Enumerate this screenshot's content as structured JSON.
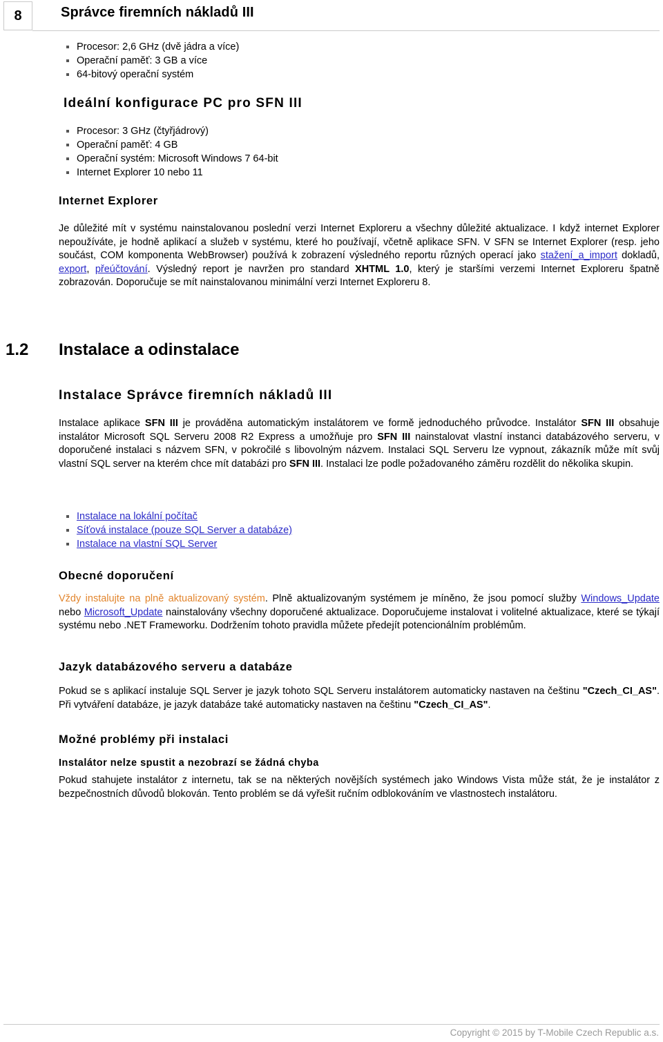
{
  "header": {
    "page_number": "8",
    "title": "Správce firemních nákladů III"
  },
  "requirements_min": {
    "items": [
      "Procesor: 2,6 GHz (dvě jádra a více)",
      "Operační paměť: 3 GB a více",
      "64-bitový operační systém"
    ]
  },
  "ideal_config": {
    "heading": "Ideální konfigurace PC pro SFN III",
    "items": [
      "Procesor: 3 GHz (čtyřjádrový)",
      "Operační paměť: 4 GB",
      "Operační systém: Microsoft Windows 7 64-bit",
      "Internet Explorer 10 nebo 11"
    ]
  },
  "internet_explorer": {
    "heading": "Internet Explorer",
    "para_part1": "Je důležité mít v systému nainstalovanou poslední verzi Internet Exploreru a všechny důležité aktualizace. I když internet Explorer nepoužíváte, je hodně aplikací a služeb v systému, které ho používají, včetně aplikace SFN. V SFN se Internet Explorer (resp. jeho součást, COM komponenta WebBrowser) používá k zobrazení výsledného reportu různých operací jako ",
    "link_download": "stažení_a_import",
    "para_part2": " dokladů, ",
    "link_export": "export",
    "para_part3": ", ",
    "link_repost": "přeúčtování",
    "para_part4": ". Výsledný report je navržen pro standard ",
    "standard_bold": "XHTML 1.0",
    "para_part5": ", který je staršími verzemi Internet Exploreru špatně zobrazován. Doporučuje se mít nainstalovanou minimální verzi Internet Exploreru 8."
  },
  "section_1_2": {
    "number": "1.2",
    "title": "Instalace a odinstalace"
  },
  "install_sfn": {
    "heading": "Instalace Správce firemních nákladů III",
    "p1_a": "Instalace aplikace ",
    "p1_b": "SFN III",
    "p1_c": " je prováděna automatickým instalátorem ve formě jednoduchého průvodce. Instalátor ",
    "p1_d": "SFN III",
    "p1_e": " obsahuje instalátor Microsoft SQL Serveru 2008 R2 Express a umožňuje pro ",
    "p1_f": "SFN III",
    "p1_g": " nainstalovat vlastní instanci databázového serveru, v doporučené instalaci s názvem SFN, v pokročilé s libovolným názvem. Instalaci SQL Serveru lze vypnout, zákazník může mít svůj vlastní SQL server na kterém chce mít databázi pro ",
    "p1_h": "SFN III",
    "p1_i": ". Instalaci lze podle požadovaného záměru rozdělit do několika skupin.",
    "links": [
      "Instalace na lokální počítač",
      "Síťová instalace (pouze SQL Server a databáze)",
      "Instalace na vlastní SQL Server"
    ]
  },
  "general_recommendation": {
    "heading": "Obecné doporučení",
    "highlight": "Vždy instalujte na plně aktualizovaný systém",
    "p_a": ". Plně aktualizovaným systémem je míněno, že jsou pomocí služby ",
    "link_windows_update": "Windows_Update",
    "p_b": " nebo ",
    "link_microsoft_update": "Microsoft_Update",
    "p_c": " nainstalovány všechny doporučené aktualizace. Doporučujeme instalovat i volitelné aktualizace, které se týkají systému nebo .NET Frameworku. Dodržením tohoto pravidla můžete předejít potencionálním problémům."
  },
  "db_language": {
    "heading": "Jazyk databázového serveru a databáze",
    "p_a": "Pokud se s aplikací instaluje SQL Server je jazyk tohoto SQL Serveru instalátorem automaticky nastaven na češtinu ",
    "collation_1": "\"Czech_CI_AS\"",
    "p_b": ". Při vytváření databáze, je jazyk databáze také automaticky nastaven na češtinu ",
    "collation_2": "\"Czech_CI_AS\"",
    "p_c": "."
  },
  "install_problems": {
    "heading": "Možné problémy při instalaci",
    "subheading": "Instalátor nelze spustit a nezobrazí se žádná chyba",
    "paragraph": "Pokud stahujete instalátor z internetu, tak se na některých novějších systémech jako Windows Vista může stát, že je instalátor z bezpečnostních důvodů blokován. Tento problém se dá vyřešit ručním odblokováním ve vlastnostech instalátoru."
  },
  "footer": {
    "copyright": "Copyright © 2015 by T-Mobile Czech Republic a.s."
  },
  "colors": {
    "link": "#2b2bc8",
    "highlight": "#e2852d",
    "rule": "#c9c9c9",
    "footer_text": "#9a9a9a"
  }
}
